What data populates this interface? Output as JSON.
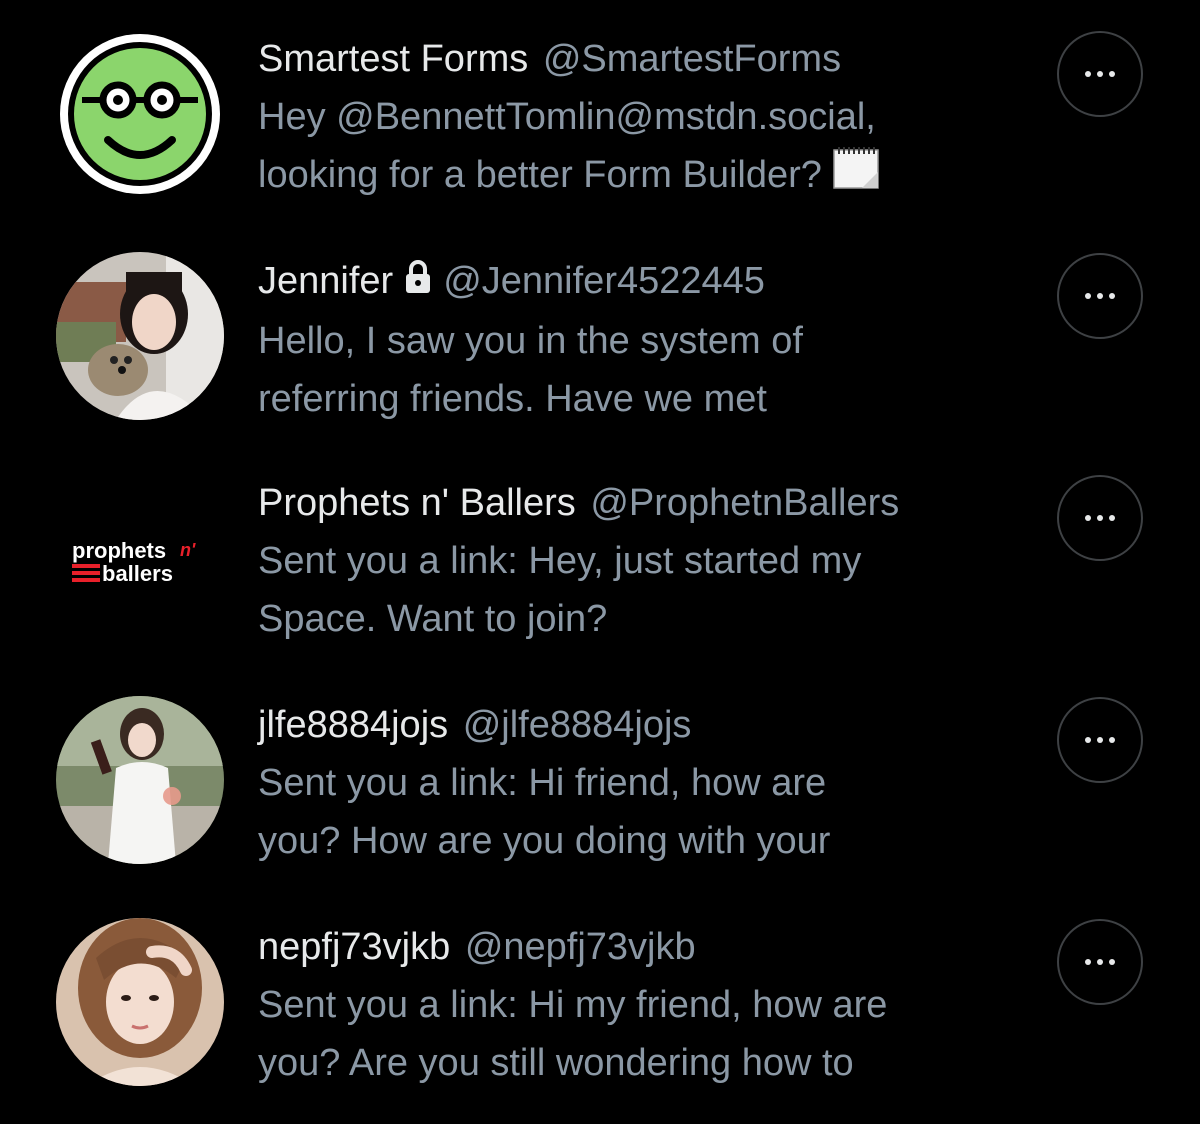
{
  "colors": {
    "background": "#000000",
    "name": "#e7e9ea",
    "secondary": "#8b98a5",
    "smiley_green": "#8bd56c",
    "logo_red": "#e8202a"
  },
  "items": [
    {
      "name": "Smartest Forms",
      "handle": "@SmartestForms",
      "text": "Hey @BennettTomlin@mstdn.social,\nlooking for a better Form Builder?",
      "avatar": "green-smiley-glasses-icon",
      "trailing_icon": "notepad-icon"
    },
    {
      "name": "Jennifer",
      "handle": "@Jennifer4522445",
      "text": "Hello, I saw you in the system of\nreferring friends. Have we met",
      "avatar": "woman-with-dog-photo",
      "name_icon": "lock-icon"
    },
    {
      "name": "Prophets n' Ballers",
      "handle": "@ProphetnBallers",
      "text": "Sent you a link: Hey, just started my\nSpace. Want to join?",
      "avatar": "prophets-ballers-logo",
      "logo_text_1": "prophets",
      "logo_text_2": "n'",
      "logo_text_3": "ballers"
    },
    {
      "name": "jlfe8884jojs",
      "handle": "@jlfe8884jojs",
      "text": "Sent you a link: Hi friend, how are\nyou? How are you doing with your",
      "avatar": "woman-in-white-photo"
    },
    {
      "name": "nepfj73vjkb",
      "handle": "@nepfj73vjkb",
      "text": "Sent you a link: Hi my friend, how are\nyou? Are you still wondering how to",
      "avatar": "woman-portrait-photo"
    }
  ]
}
